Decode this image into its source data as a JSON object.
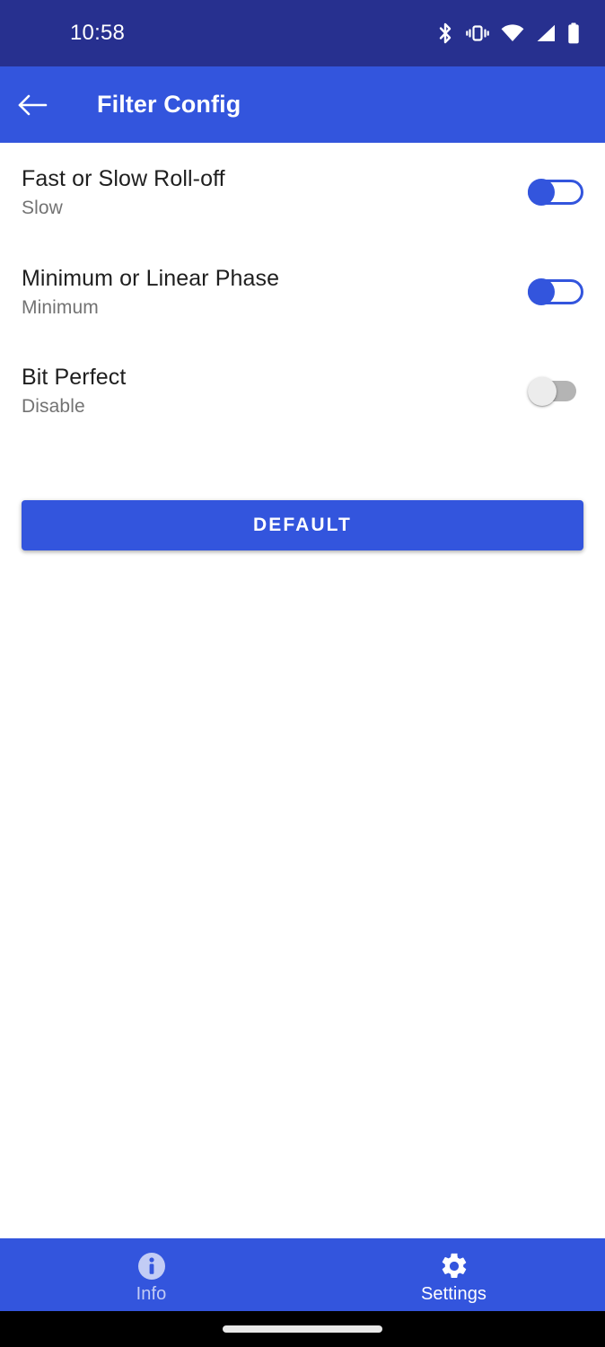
{
  "status_bar": {
    "time": "10:58",
    "icons": [
      "bluetooth-icon",
      "vibrate-icon",
      "wifi-icon",
      "cellular-signal-icon",
      "battery-icon"
    ],
    "background_color": "#27308F",
    "foreground_color": "#FFFFFF"
  },
  "app_bar": {
    "back_icon": "back-arrow-icon",
    "title": "Filter Config",
    "background_color": "#3355DD",
    "foreground_color": "#FFFFFF"
  },
  "preferences": [
    {
      "title": "Fast or Slow Roll-off",
      "summary": "Slow",
      "switch_state": "on",
      "switch_label": "on"
    },
    {
      "title": "Minimum or Linear Phase",
      "summary": "Minimum",
      "switch_state": "on",
      "switch_label": "on"
    },
    {
      "title": "Bit Perfect",
      "summary": "Disable",
      "switch_state": "off",
      "switch_label": "off"
    }
  ],
  "actions": {
    "default_button_label": "DEFAULT"
  },
  "bottom_nav": {
    "background_color": "#3355DD",
    "items": [
      {
        "label": "Info",
        "icon": "info-circle-icon",
        "active": false
      },
      {
        "label": "Settings",
        "icon": "gear-icon",
        "active": true
      }
    ]
  },
  "colors": {
    "status_bar": "#27308F",
    "primary": "#3355DD",
    "switch_on": "#3355DD",
    "switch_off_track": "#B4B4B4",
    "switch_off_thumb": "#ECECEC",
    "title_text": "#1F1F1F",
    "summary_text": "#737373",
    "nav_inactive": "#C2CCF5",
    "page_background": "#FFFFFF",
    "gesture_bar": "#E8E8E8"
  }
}
